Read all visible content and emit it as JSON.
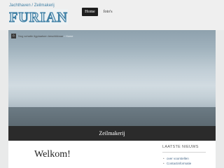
{
  "header": {
    "logo_tagline": "Jachthaven / Zeilmakerij",
    "logo_name": "FURIAN",
    "colors": {
      "logo_blue": "#3f7fa4",
      "logo_fill": "#dfeaf1"
    }
  },
  "nav": {
    "items": [
      {
        "label": "Home",
        "active": true
      },
      {
        "label": "foto's",
        "active": false
      }
    ]
  },
  "breadcrumb": {
    "icon": "home-icon",
    "text": "Nog schattn ligplaatsen beschikbaar",
    "trail": "Home"
  },
  "banner": {
    "title": "Zeilmakerij"
  },
  "main": {
    "heading": "Welkom!"
  },
  "sidebar": {
    "title": "LAATSTE NIEUWS",
    "items": [
      {
        "label": "over voorstellen"
      },
      {
        "label": "Contactinformatie"
      }
    ]
  }
}
